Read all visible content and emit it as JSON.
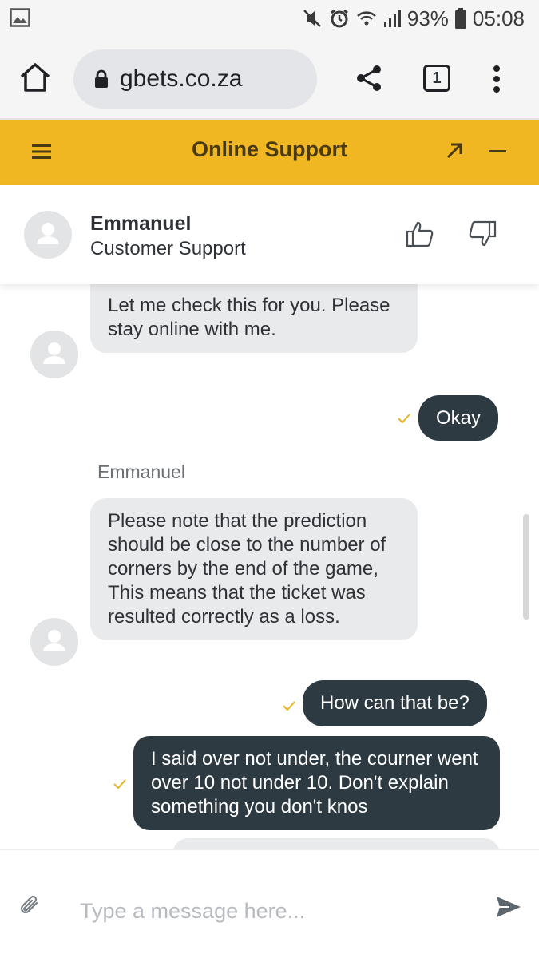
{
  "status_bar": {
    "battery": "93%",
    "time": "05:08",
    "icons": [
      "image-notification-icon",
      "mute-icon",
      "alarm-icon",
      "wifi-icon",
      "signal-icon",
      "battery-icon"
    ]
  },
  "browser": {
    "url": "gbets.co.za",
    "tab_count": "1",
    "icons": [
      "home-icon",
      "lock-icon",
      "share-icon",
      "tabs-icon",
      "more-vert-icon"
    ]
  },
  "support_header": {
    "title": "Online Support",
    "accent_color": "#f0b723"
  },
  "agent": {
    "name": "Emmanuel",
    "role": "Customer Support"
  },
  "messages": [
    {
      "from": "agent",
      "text": "Let me check this for you. Please stay online with me."
    },
    {
      "from": "user",
      "text": "Okay",
      "status": "sent-check-icon"
    },
    {
      "from": "agent",
      "sender": "Emmanuel",
      "text": "Please note that the prediction should be close to the number of corners by the end of the game, This means that the ticket was resulted correctly as a loss."
    },
    {
      "from": "user",
      "text": "How can that be?",
      "status": "sent-check-icon"
    },
    {
      "from": "user",
      "text": "I said over not under, the courner went over 10  not under 10. Don't explain something you don't knos",
      "status": "sent-check-icon"
    }
  ],
  "composer": {
    "placeholder": "Type a message here..."
  }
}
